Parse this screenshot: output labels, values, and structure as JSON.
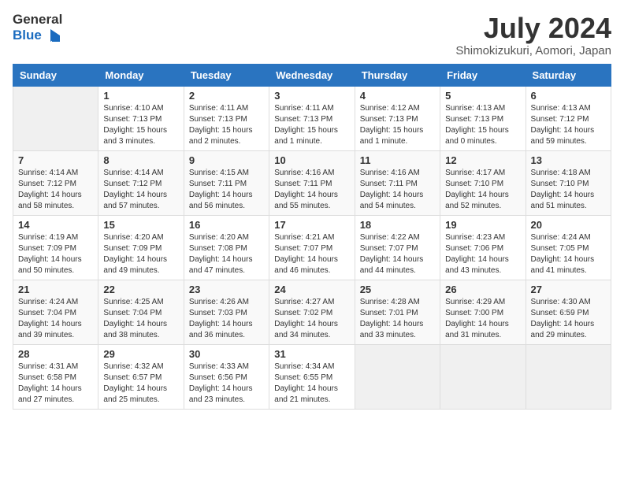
{
  "header": {
    "logo_line1": "General",
    "logo_line2": "Blue",
    "month": "July 2024",
    "location": "Shimokizukuri, Aomori, Japan"
  },
  "days_of_week": [
    "Sunday",
    "Monday",
    "Tuesday",
    "Wednesday",
    "Thursday",
    "Friday",
    "Saturday"
  ],
  "weeks": [
    [
      {
        "day": "",
        "empty": true
      },
      {
        "day": "1",
        "sunrise": "Sunrise: 4:10 AM",
        "sunset": "Sunset: 7:13 PM",
        "daylight": "Daylight: 15 hours and 3 minutes."
      },
      {
        "day": "2",
        "sunrise": "Sunrise: 4:11 AM",
        "sunset": "Sunset: 7:13 PM",
        "daylight": "Daylight: 15 hours and 2 minutes."
      },
      {
        "day": "3",
        "sunrise": "Sunrise: 4:11 AM",
        "sunset": "Sunset: 7:13 PM",
        "daylight": "Daylight: 15 hours and 1 minute."
      },
      {
        "day": "4",
        "sunrise": "Sunrise: 4:12 AM",
        "sunset": "Sunset: 7:13 PM",
        "daylight": "Daylight: 15 hours and 1 minute."
      },
      {
        "day": "5",
        "sunrise": "Sunrise: 4:13 AM",
        "sunset": "Sunset: 7:13 PM",
        "daylight": "Daylight: 15 hours and 0 minutes."
      },
      {
        "day": "6",
        "sunrise": "Sunrise: 4:13 AM",
        "sunset": "Sunset: 7:12 PM",
        "daylight": "Daylight: 14 hours and 59 minutes."
      }
    ],
    [
      {
        "day": "7",
        "sunrise": "Sunrise: 4:14 AM",
        "sunset": "Sunset: 7:12 PM",
        "daylight": "Daylight: 14 hours and 58 minutes."
      },
      {
        "day": "8",
        "sunrise": "Sunrise: 4:14 AM",
        "sunset": "Sunset: 7:12 PM",
        "daylight": "Daylight: 14 hours and 57 minutes."
      },
      {
        "day": "9",
        "sunrise": "Sunrise: 4:15 AM",
        "sunset": "Sunset: 7:11 PM",
        "daylight": "Daylight: 14 hours and 56 minutes."
      },
      {
        "day": "10",
        "sunrise": "Sunrise: 4:16 AM",
        "sunset": "Sunset: 7:11 PM",
        "daylight": "Daylight: 14 hours and 55 minutes."
      },
      {
        "day": "11",
        "sunrise": "Sunrise: 4:16 AM",
        "sunset": "Sunset: 7:11 PM",
        "daylight": "Daylight: 14 hours and 54 minutes."
      },
      {
        "day": "12",
        "sunrise": "Sunrise: 4:17 AM",
        "sunset": "Sunset: 7:10 PM",
        "daylight": "Daylight: 14 hours and 52 minutes."
      },
      {
        "day": "13",
        "sunrise": "Sunrise: 4:18 AM",
        "sunset": "Sunset: 7:10 PM",
        "daylight": "Daylight: 14 hours and 51 minutes."
      }
    ],
    [
      {
        "day": "14",
        "sunrise": "Sunrise: 4:19 AM",
        "sunset": "Sunset: 7:09 PM",
        "daylight": "Daylight: 14 hours and 50 minutes."
      },
      {
        "day": "15",
        "sunrise": "Sunrise: 4:20 AM",
        "sunset": "Sunset: 7:09 PM",
        "daylight": "Daylight: 14 hours and 49 minutes."
      },
      {
        "day": "16",
        "sunrise": "Sunrise: 4:20 AM",
        "sunset": "Sunset: 7:08 PM",
        "daylight": "Daylight: 14 hours and 47 minutes."
      },
      {
        "day": "17",
        "sunrise": "Sunrise: 4:21 AM",
        "sunset": "Sunset: 7:07 PM",
        "daylight": "Daylight: 14 hours and 46 minutes."
      },
      {
        "day": "18",
        "sunrise": "Sunrise: 4:22 AM",
        "sunset": "Sunset: 7:07 PM",
        "daylight": "Daylight: 14 hours and 44 minutes."
      },
      {
        "day": "19",
        "sunrise": "Sunrise: 4:23 AM",
        "sunset": "Sunset: 7:06 PM",
        "daylight": "Daylight: 14 hours and 43 minutes."
      },
      {
        "day": "20",
        "sunrise": "Sunrise: 4:24 AM",
        "sunset": "Sunset: 7:05 PM",
        "daylight": "Daylight: 14 hours and 41 minutes."
      }
    ],
    [
      {
        "day": "21",
        "sunrise": "Sunrise: 4:24 AM",
        "sunset": "Sunset: 7:04 PM",
        "daylight": "Daylight: 14 hours and 39 minutes."
      },
      {
        "day": "22",
        "sunrise": "Sunrise: 4:25 AM",
        "sunset": "Sunset: 7:04 PM",
        "daylight": "Daylight: 14 hours and 38 minutes."
      },
      {
        "day": "23",
        "sunrise": "Sunrise: 4:26 AM",
        "sunset": "Sunset: 7:03 PM",
        "daylight": "Daylight: 14 hours and 36 minutes."
      },
      {
        "day": "24",
        "sunrise": "Sunrise: 4:27 AM",
        "sunset": "Sunset: 7:02 PM",
        "daylight": "Daylight: 14 hours and 34 minutes."
      },
      {
        "day": "25",
        "sunrise": "Sunrise: 4:28 AM",
        "sunset": "Sunset: 7:01 PM",
        "daylight": "Daylight: 14 hours and 33 minutes."
      },
      {
        "day": "26",
        "sunrise": "Sunrise: 4:29 AM",
        "sunset": "Sunset: 7:00 PM",
        "daylight": "Daylight: 14 hours and 31 minutes."
      },
      {
        "day": "27",
        "sunrise": "Sunrise: 4:30 AM",
        "sunset": "Sunset: 6:59 PM",
        "daylight": "Daylight: 14 hours and 29 minutes."
      }
    ],
    [
      {
        "day": "28",
        "sunrise": "Sunrise: 4:31 AM",
        "sunset": "Sunset: 6:58 PM",
        "daylight": "Daylight: 14 hours and 27 minutes."
      },
      {
        "day": "29",
        "sunrise": "Sunrise: 4:32 AM",
        "sunset": "Sunset: 6:57 PM",
        "daylight": "Daylight: 14 hours and 25 minutes."
      },
      {
        "day": "30",
        "sunrise": "Sunrise: 4:33 AM",
        "sunset": "Sunset: 6:56 PM",
        "daylight": "Daylight: 14 hours and 23 minutes."
      },
      {
        "day": "31",
        "sunrise": "Sunrise: 4:34 AM",
        "sunset": "Sunset: 6:55 PM",
        "daylight": "Daylight: 14 hours and 21 minutes."
      },
      {
        "day": "",
        "empty": true
      },
      {
        "day": "",
        "empty": true
      },
      {
        "day": "",
        "empty": true
      }
    ]
  ]
}
